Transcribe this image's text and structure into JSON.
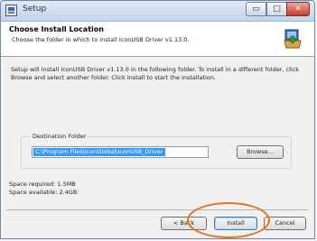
{
  "window": {
    "title": "Setup",
    "min_glyph": "▭",
    "max_glyph": "□",
    "close_glyph": "✕"
  },
  "header": {
    "title": "Choose Install Location",
    "subtitle": "Choose the folder in which to install IconUSB Driver v1.13.0.",
    "icon": "installer-box-icon"
  },
  "body": {
    "description": "Setup will install IconUSB Driver v1.13.0 in the following folder. To install in a different folder, click Browse and select another folder. Click Install to start the installation."
  },
  "destination": {
    "label": "Destination Folder",
    "path": "C:\\Program Files\\IconGlobal\\IconUSB_Driver",
    "browse_label": "Browse..."
  },
  "space": {
    "required": "Space required: 1.5MB",
    "available": "Space available: 2.4GB"
  },
  "footer": {
    "back_label": "< Back",
    "install_label": "Install",
    "cancel_label": "Cancel"
  },
  "colors": {
    "highlight": "#e8721f",
    "selection": "#3399ff"
  }
}
